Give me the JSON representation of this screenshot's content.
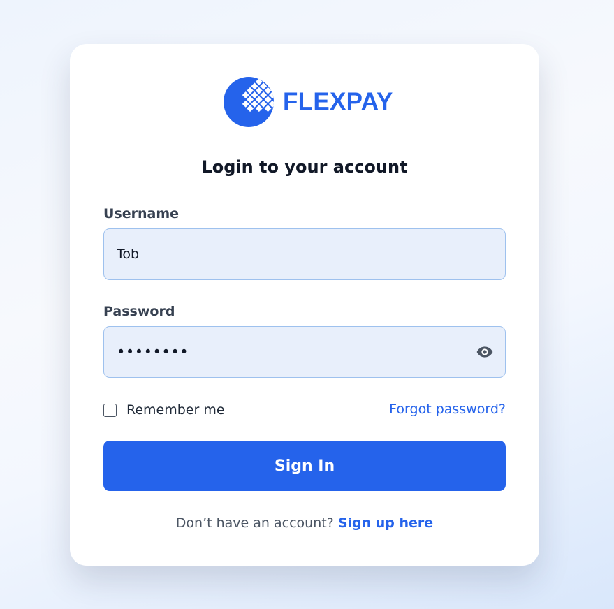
{
  "brand": {
    "name": "FLEXPAY",
    "logo_icon": "flexpay-logo-icon",
    "color": "#2563eb"
  },
  "login": {
    "heading": "Login to your account",
    "username_label": "Username",
    "username_value": "Tob",
    "password_label": "Password",
    "password_value": "••••••••",
    "password_toggle_icon": "eye-icon",
    "remember_label": "Remember me",
    "remember_checked": false,
    "forgot_link": "Forgot password?",
    "submit_label": "Sign In",
    "signup_prompt": "Don’t have an account?",
    "signup_link": "Sign up here"
  },
  "colors": {
    "accent": "#2563eb",
    "input_bg": "#e8effb",
    "input_border": "#9ec1ee"
  }
}
